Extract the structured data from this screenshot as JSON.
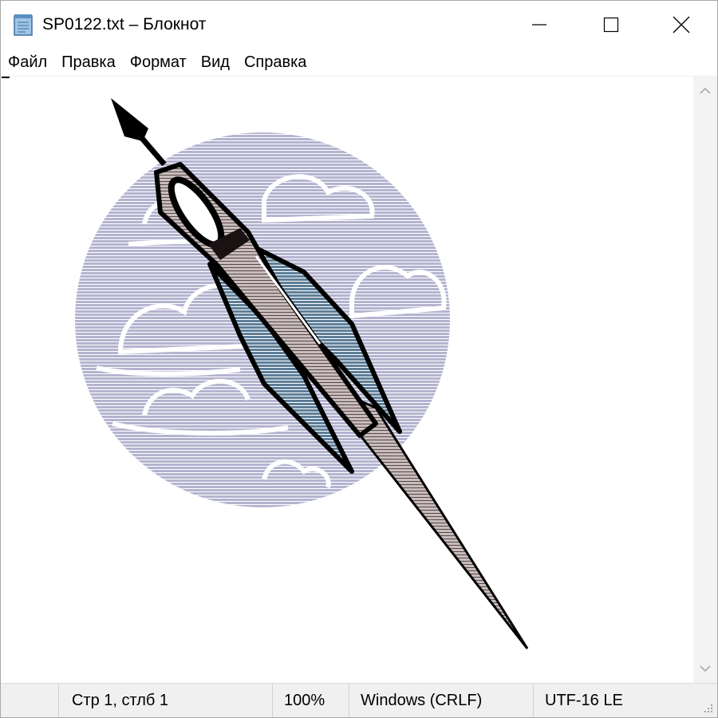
{
  "window": {
    "title": "SP0122.txt – Блокнот",
    "icon": "notepad-icon"
  },
  "title_buttons": {
    "minimize_icon": "minimize-icon",
    "maximize_icon": "maximize-icon",
    "close_icon": "close-icon"
  },
  "menu": {
    "items": [
      {
        "label": "Файл"
      },
      {
        "label": "Правка"
      },
      {
        "label": "Формат"
      },
      {
        "label": "Вид"
      },
      {
        "label": "Справка"
      }
    ]
  },
  "editor": {
    "content_description_icon": "ascii-art-rocket",
    "colors": {
      "cloud_fill": "#b4b4d0",
      "cloud_stripe": "#ffffff",
      "rocket_outline": "#000000",
      "fin_blue": "#5e7e98",
      "body_light": "#d8cccc",
      "body_dark": "#6a5a5a"
    }
  },
  "statusbar": {
    "position": "Стр 1, стлб 1",
    "zoom": "100%",
    "line_endings": "Windows (CRLF)",
    "encoding": "UTF-16 LE"
  }
}
